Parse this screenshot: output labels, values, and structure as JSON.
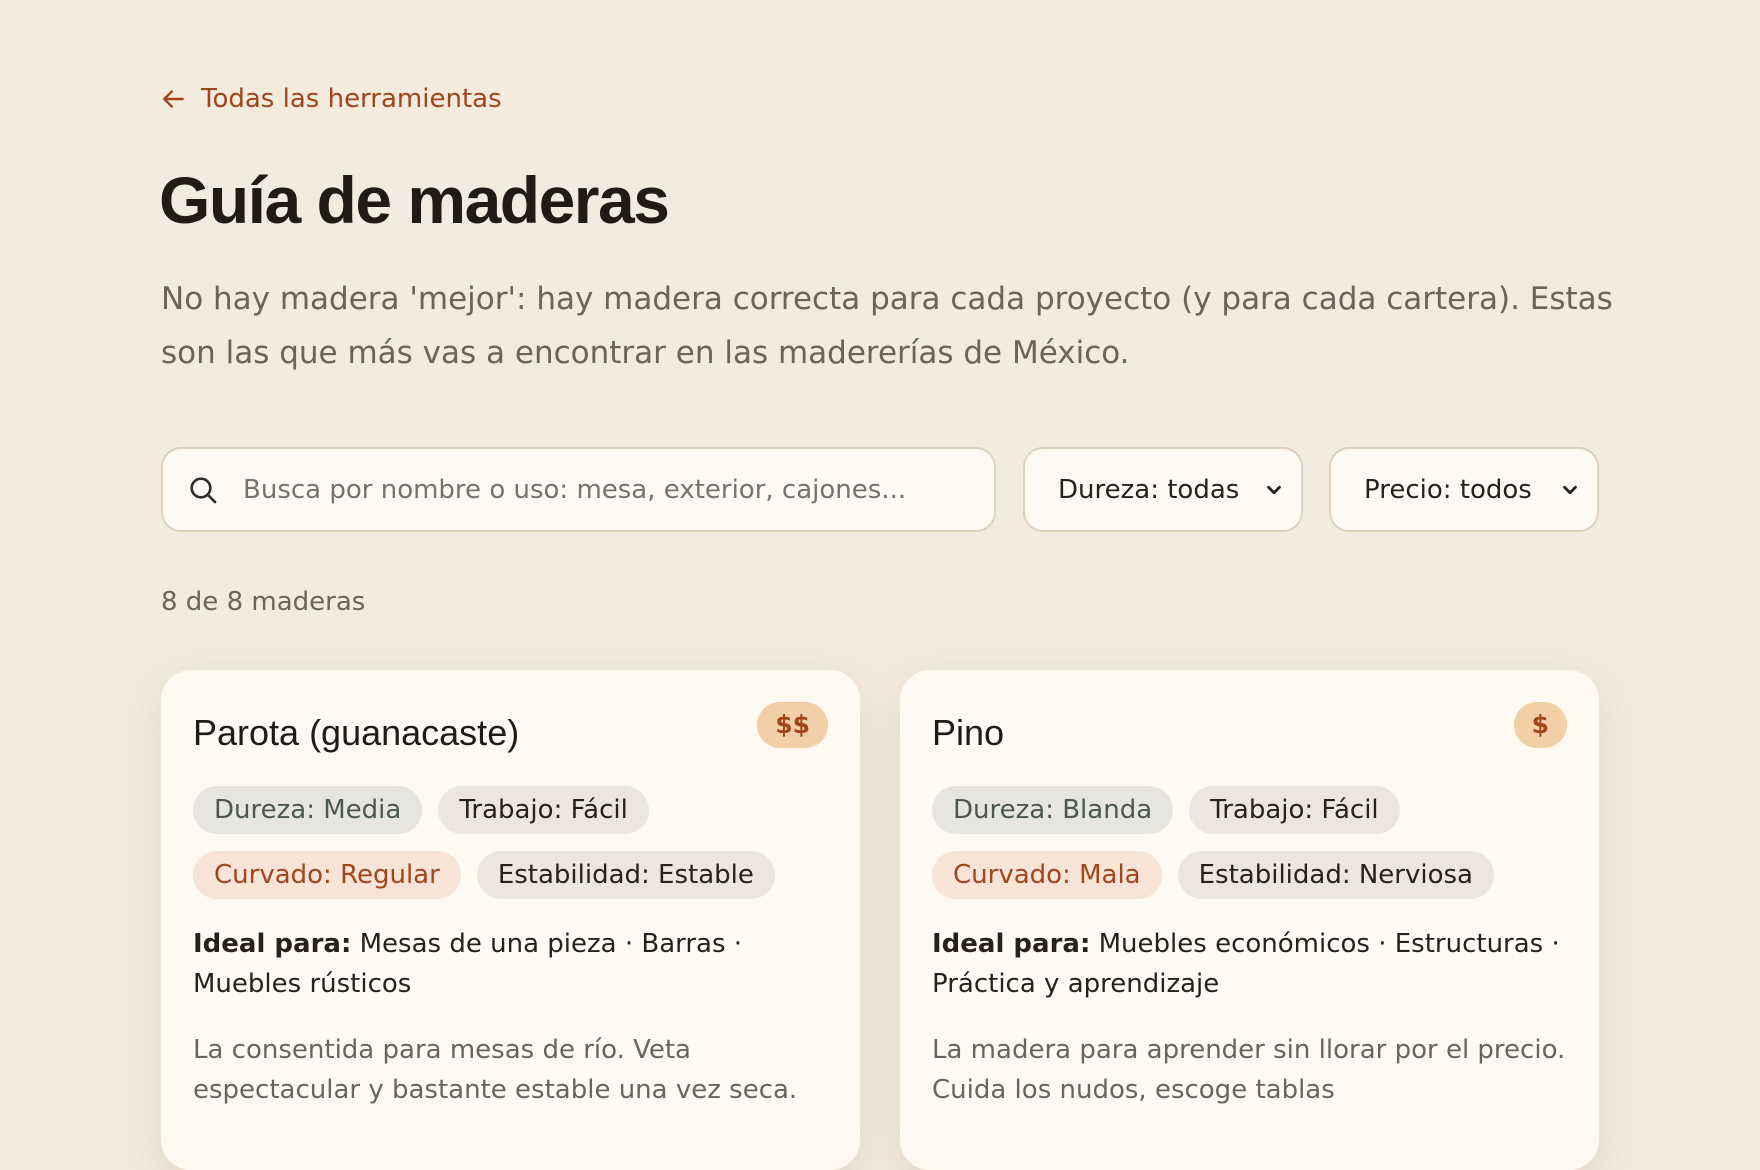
{
  "nav": {
    "back_label": "Todas las herramientas"
  },
  "header": {
    "title": "Guía de maderas",
    "intro": "No hay madera 'mejor': hay madera correcta para cada proyecto (y para cada cartera). Estas son las que más vas a encontrar en las madererías de México."
  },
  "filters": {
    "search_placeholder": "Busca por nombre o uso: mesa, exterior, cajones...",
    "dureza_selected": "Dureza: todas",
    "precio_selected": "Precio: todos"
  },
  "results": {
    "count_label": "8 de 8 maderas"
  },
  "cards": [
    {
      "name": "Parota (guanacaste)",
      "price": "$$",
      "dureza": "Dureza: Media",
      "trabajo": "Trabajo: Fácil",
      "curvado": "Curvado: Regular",
      "estabilidad": "Estabilidad: Estable",
      "ideal_label": "Ideal para:",
      "ideal_text": "Mesas de una pieza · Barras · Muebles rústicos",
      "description": "La consentida para mesas de río. Veta espectacular y bastante estable una vez seca."
    },
    {
      "name": "Pino",
      "price": "$",
      "dureza": "Dureza: Blanda",
      "trabajo": "Trabajo: Fácil",
      "curvado": "Curvado: Mala",
      "estabilidad": "Estabilidad: Nerviosa",
      "ideal_label": "Ideal para:",
      "ideal_text": "Muebles económicos · Estructuras · Práctica y aprendizaje",
      "description": "La madera para aprender sin llorar por el precio. Cuida los nudos, escoge tablas"
    }
  ],
  "colors": {
    "accent": "#a1461a",
    "background": "#f3ebde",
    "card": "#fffaf1"
  },
  "icons": {
    "back": "arrow-left-icon",
    "search": "search-icon",
    "dropdown": "chevron-down-icon"
  }
}
